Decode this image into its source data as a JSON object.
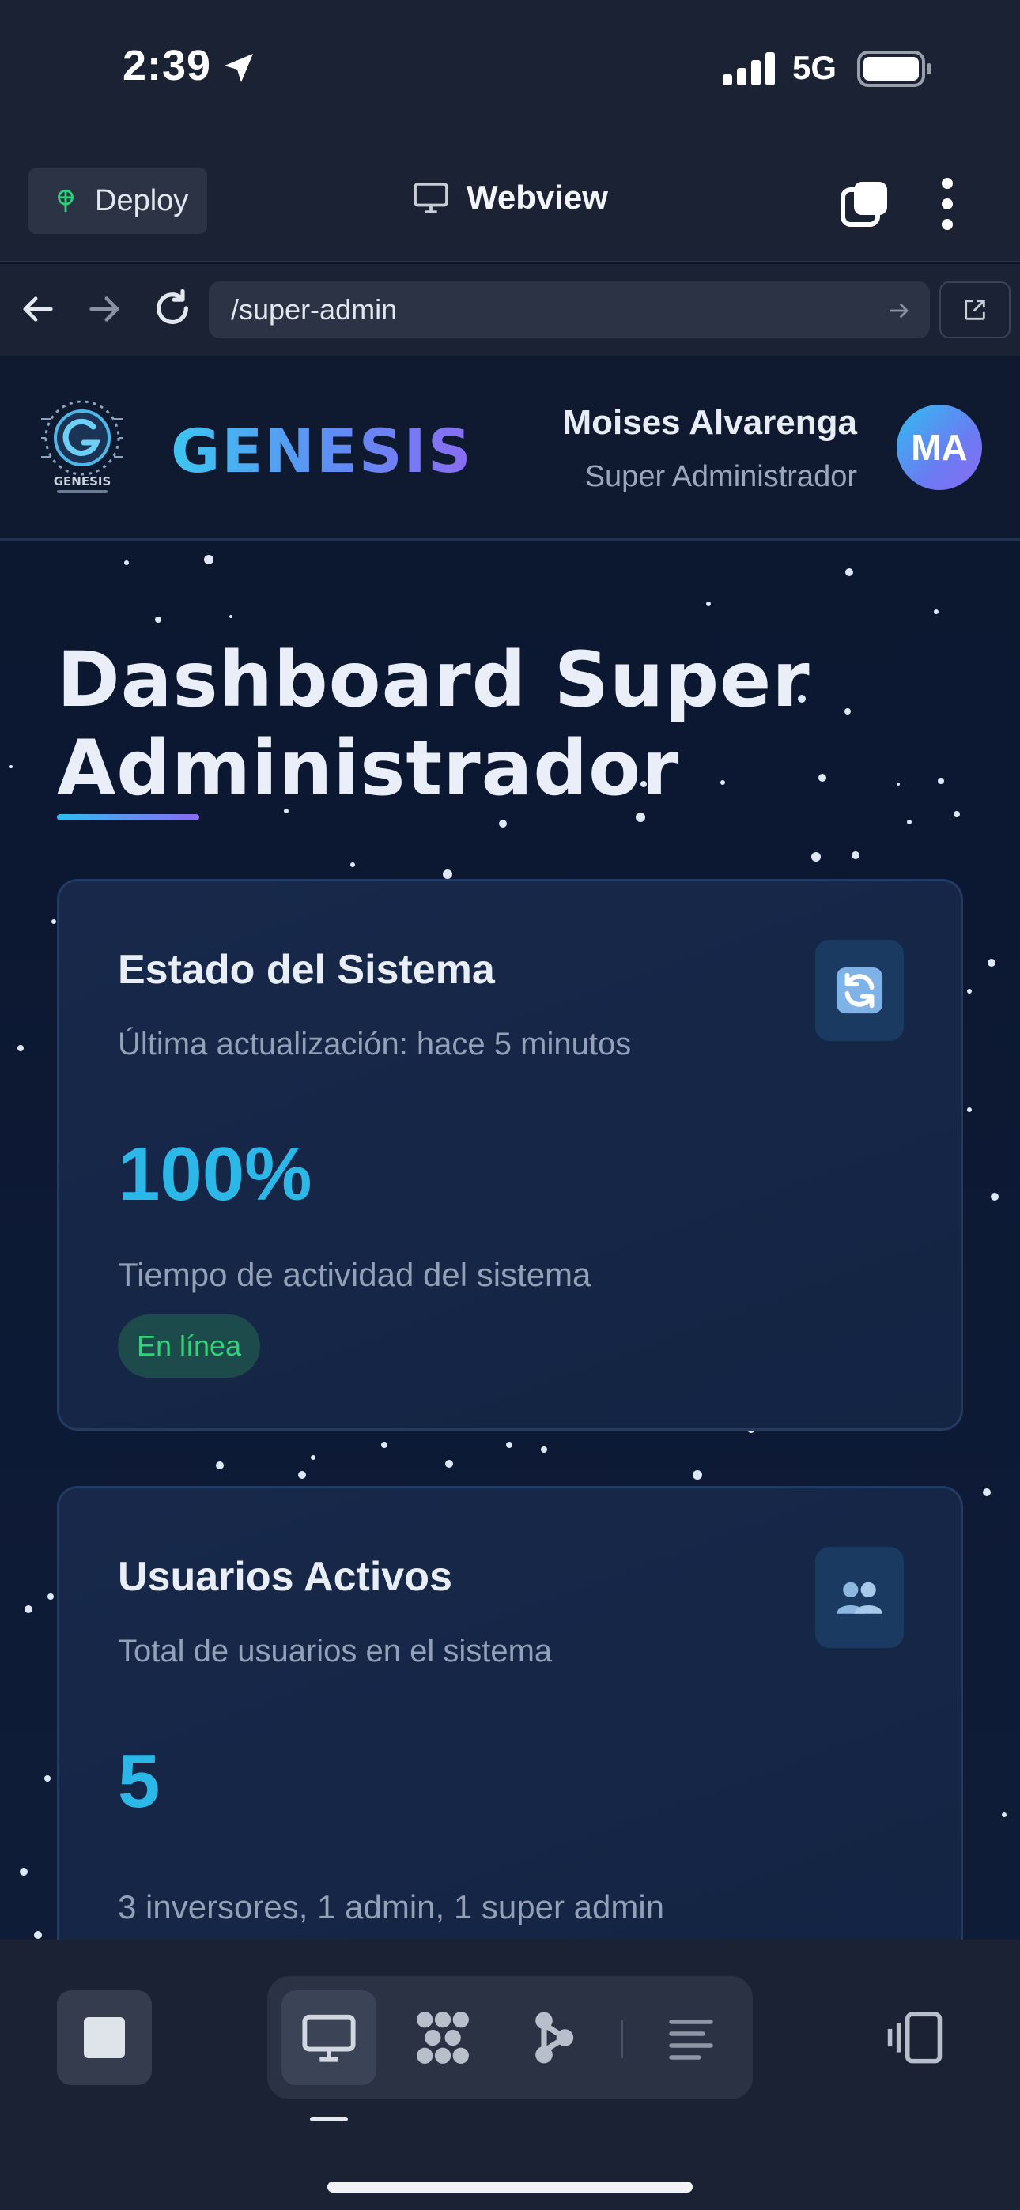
{
  "status_bar": {
    "time": "2:39",
    "network": "5G",
    "icons": [
      "location-arrow-icon",
      "signal-bars-icon",
      "battery-icon"
    ]
  },
  "toolbar": {
    "deploy_label": "Deploy",
    "webview_label": "Webview",
    "icons": [
      "deploy-icon",
      "monitor-icon",
      "tabs-icon",
      "more-vertical-icon"
    ]
  },
  "urlbar": {
    "url": "/super-admin",
    "icons": [
      "back-arrow-icon",
      "forward-arrow-icon",
      "reload-icon",
      "go-arrow-icon",
      "open-external-icon"
    ]
  },
  "header": {
    "logo_text": "GENESIS",
    "brand_name": "GENESIS",
    "user_name": "Moises Alvarenga",
    "user_role": "Super Administrador",
    "avatar_initials": "MA"
  },
  "page": {
    "title_line1": "Dashboard Super",
    "title_line2": "Administrador"
  },
  "cards": [
    {
      "title": "Estado del Sistema",
      "subtitle": "Última actualización: hace 5 minutos",
      "value": "100%",
      "caption": "Tiempo de actividad del sistema",
      "badge": "En línea",
      "icon": "refresh-icon"
    },
    {
      "title": "Usuarios Activos",
      "subtitle": "Total de usuarios en el sistema",
      "value": "5",
      "caption": "3 inversores, 1 admin, 1 super admin",
      "icon": "users-icon"
    }
  ],
  "dock": {
    "items": [
      "stop-icon",
      "webview-monitor-icon",
      "apps-grid-icon",
      "agent-icon",
      "console-lines-icon",
      "devices-icon"
    ]
  },
  "colors": {
    "accent_cyan": "#2bb8e8",
    "accent_purple": "#8a6af2",
    "status_green": "#2fd37a",
    "background": "#0d1529"
  }
}
